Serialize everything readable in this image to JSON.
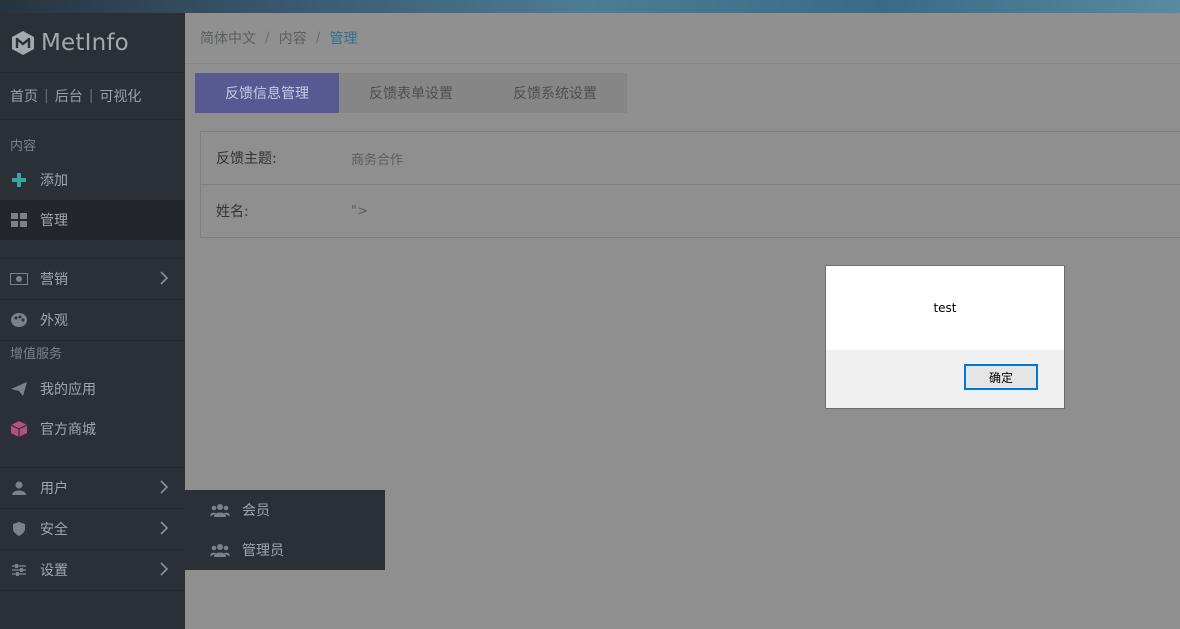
{
  "app": {
    "logo_text": "MetInfo"
  },
  "toplinks": {
    "home": "首页",
    "backend": "后台",
    "visual": "可视化"
  },
  "sidebar": {
    "section_content": "内容",
    "add": "添加",
    "manage": "管理",
    "marketing": "营销",
    "appearance": "外观",
    "section_services": "增值服务",
    "my_apps": "我的应用",
    "official_store": "官方商城",
    "users": "用户",
    "security": "安全",
    "settings": "设置"
  },
  "flyout": {
    "member": "会员",
    "admin": "管理员"
  },
  "breadcrumb": {
    "lang": "简体中文",
    "content": "内容",
    "current": "管理"
  },
  "tabs": [
    "反馈信息管理",
    "反馈表单设置",
    "反馈系统设置"
  ],
  "form": {
    "rows": [
      {
        "label": "反馈主题:",
        "value": "商务合作"
      },
      {
        "label": "姓名:",
        "value": "\">"
      }
    ]
  },
  "dialog": {
    "message": "test",
    "ok_label": "确定"
  },
  "colors": {
    "accent": "#575a92",
    "sidebar_bg": "#2b3036",
    "overlay": "#8f8f8f",
    "focus": "#0078d7"
  }
}
